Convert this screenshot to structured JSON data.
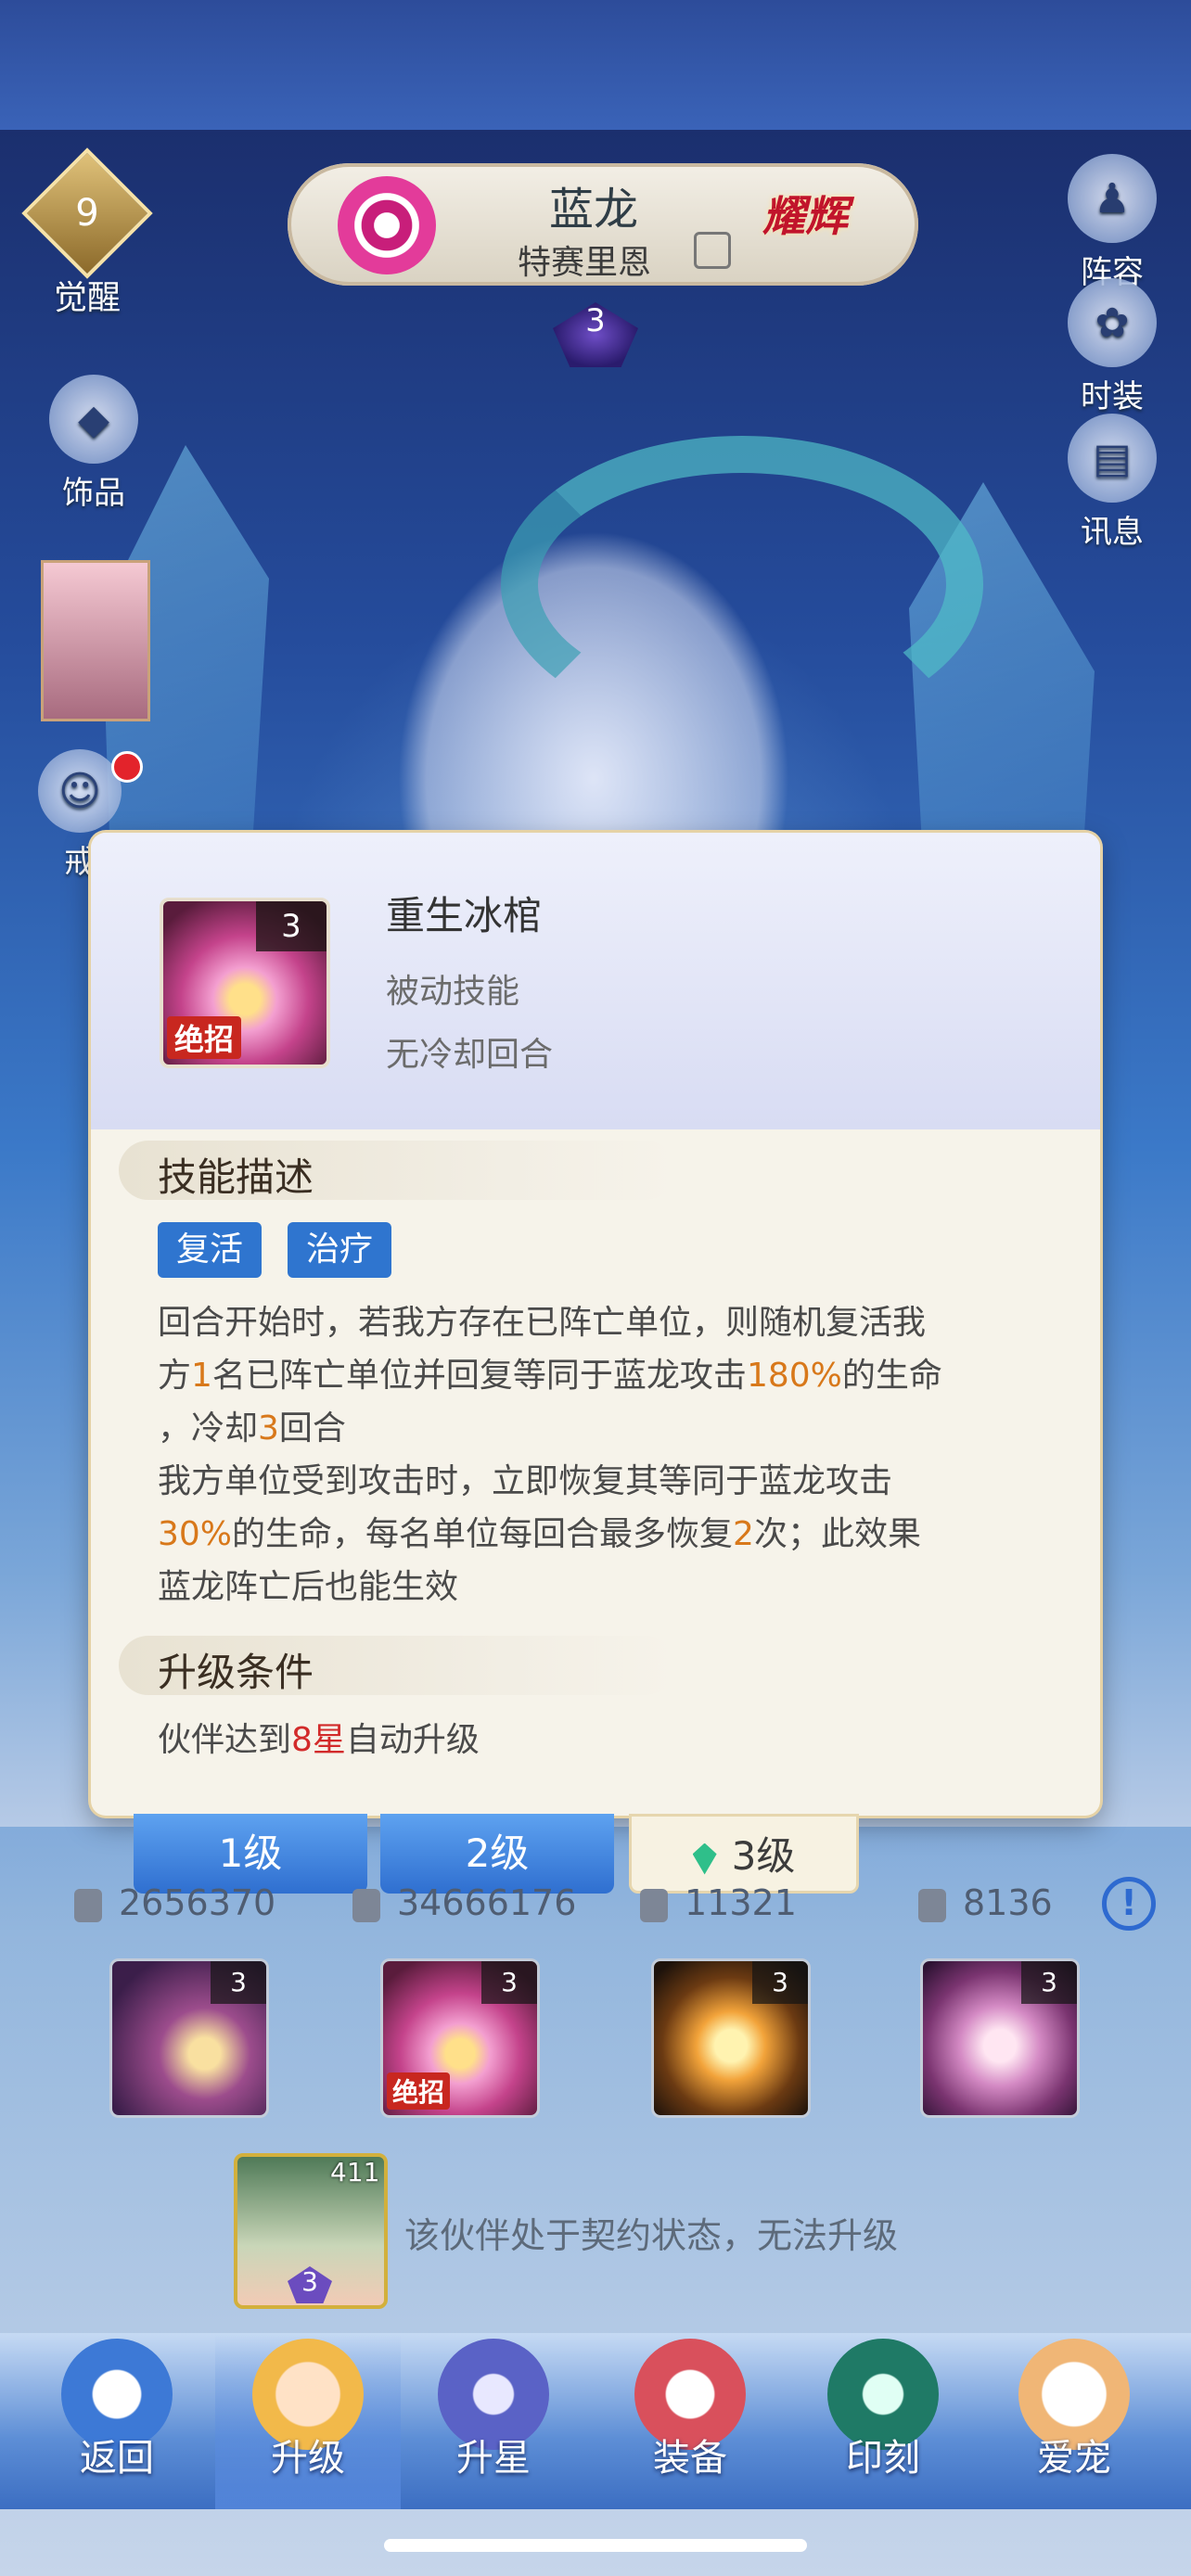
{
  "hero": {
    "name": "蓝龙",
    "subtitle": "特赛里恩",
    "rank_badge": "耀辉",
    "star_count": "3"
  },
  "side_left": {
    "awaken_level": "9",
    "awaken_label": "觉醒",
    "accessory_label": "饰品",
    "ring_label": "戒"
  },
  "side_right": {
    "lineup_label": "阵容",
    "fashion_label": "时装",
    "info_label": "讯息"
  },
  "skill_popup": {
    "icon_level": "3",
    "icon_tag": "绝招",
    "name": "重生冰棺",
    "type": "被动技能",
    "cooldown": "无冷却回合",
    "section_desc_title": "技能描述",
    "tags": [
      "复活",
      "治疗"
    ],
    "desc": {
      "p1": "回合开始时，若我方存在已阵亡单位，则随机复活我",
      "p2a": "方",
      "p2n": "1",
      "p2b": "名已阵亡单位并回复等同于蓝龙攻击",
      "p2p": "180%",
      "p2c": "的生命",
      "p3a": "，冷却",
      "p3n": "3",
      "p3b": "回合",
      "p4": "我方单位受到攻击时，立即恢复其等同于蓝龙攻击",
      "p5p": "30%",
      "p5a": "的生命，每名单位每回合最多恢复",
      "p5n": "2",
      "p5b": "次；此效果",
      "p6": "蓝龙阵亡后也能生效"
    },
    "section_upgrade_title": "升级条件",
    "upgrade": {
      "pre": "伙伴达到",
      "num": "8星",
      "post": "自动升级"
    }
  },
  "level_tabs": [
    "1级",
    "2级",
    "3级"
  ],
  "stats": {
    "attack": "2656370",
    "hp": "34666176",
    "defense": "11321",
    "speed": "8136"
  },
  "skill_slots": [
    {
      "level": "3",
      "tag": ""
    },
    {
      "level": "3",
      "tag": "绝招"
    },
    {
      "level": "3",
      "tag": ""
    },
    {
      "level": "3",
      "tag": ""
    }
  ],
  "partner": {
    "number": "411",
    "star": "3",
    "message": "该伙伴处于契约状态，无法升级"
  },
  "nav": {
    "back": "返回",
    "upgrade": "升级",
    "star_up": "升星",
    "equip": "装备",
    "imprint": "印刻",
    "pet": "爱宠"
  },
  "colors": {
    "accent_blue": "#2f75cf",
    "highlight_orange": "#d8781a",
    "highlight_red": "#d22a2a"
  }
}
